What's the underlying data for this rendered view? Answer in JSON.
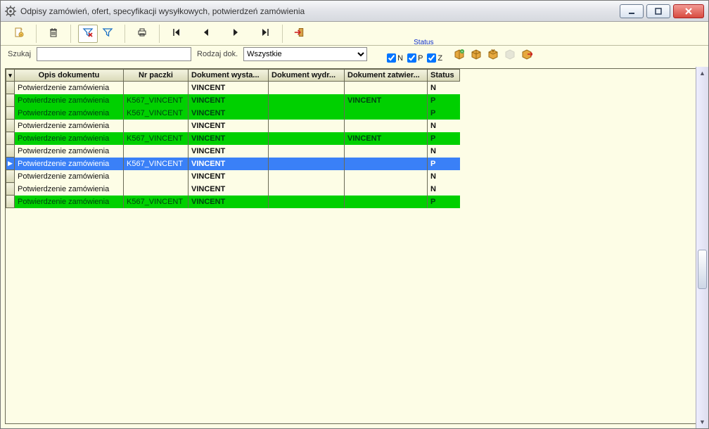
{
  "window": {
    "title": "Odpisy zamówień, ofert, specyfikacji wysyłkowych, potwierdzeń zamówienia"
  },
  "search": {
    "szukajLabel": "Szukaj",
    "szukajValue": "",
    "rodzajLabel": "Rodzaj dok.",
    "rodzajValue": "Wszystkie",
    "statusLabel": "Status",
    "chkN": "N",
    "chkP": "P",
    "chkZ": "Z"
  },
  "grid": {
    "headers": {
      "opis": "Opis dokumentu",
      "paczki": "Nr paczki",
      "wyst": "Dokument wysta...",
      "wydr": "Dokument wydr...",
      "zatw": "Dokument zatwier...",
      "status": "Status"
    },
    "rows": [
      {
        "opis": "Potwierdzenie zamówienia",
        "paczki": "",
        "wyst": "VINCENT",
        "wydr": "",
        "zatw": "",
        "status": "N",
        "sel": false
      },
      {
        "opis": "Potwierdzenie zamówienia",
        "paczki": "K567_VINCENT",
        "wyst": "VINCENT",
        "wydr": "",
        "zatw": "VINCENT",
        "status": "P",
        "sel": false
      },
      {
        "opis": "Potwierdzenie zamówienia",
        "paczki": "K567_VINCENT",
        "wyst": "VINCENT",
        "wydr": "",
        "zatw": "",
        "status": "P",
        "sel": false
      },
      {
        "opis": "Potwierdzenie zamówienia",
        "paczki": "",
        "wyst": "VINCENT",
        "wydr": "",
        "zatw": "",
        "status": "N",
        "sel": false
      },
      {
        "opis": "Potwierdzenie zamówienia",
        "paczki": "K567_VINCENT",
        "wyst": "VINCENT",
        "wydr": "",
        "zatw": "VINCENT",
        "status": "P",
        "sel": false
      },
      {
        "opis": "Potwierdzenie zamówienia",
        "paczki": "",
        "wyst": "VINCENT",
        "wydr": "",
        "zatw": "",
        "status": "N",
        "sel": false
      },
      {
        "opis": "Potwierdzenie zamówienia",
        "paczki": "K567_VINCENT",
        "wyst": "VINCENT",
        "wydr": "",
        "zatw": "",
        "status": "P",
        "sel": true
      },
      {
        "opis": "Potwierdzenie zamówienia",
        "paczki": "",
        "wyst": "VINCENT",
        "wydr": "",
        "zatw": "",
        "status": "N",
        "sel": false
      },
      {
        "opis": "Potwierdzenie zamówienia",
        "paczki": "",
        "wyst": "VINCENT",
        "wydr": "",
        "zatw": "",
        "status": "N",
        "sel": false
      },
      {
        "opis": "Potwierdzenie zamówienia",
        "paczki": "K567_VINCENT",
        "wyst": "VINCENT",
        "wydr": "",
        "zatw": "",
        "status": "P",
        "sel": false
      }
    ]
  }
}
